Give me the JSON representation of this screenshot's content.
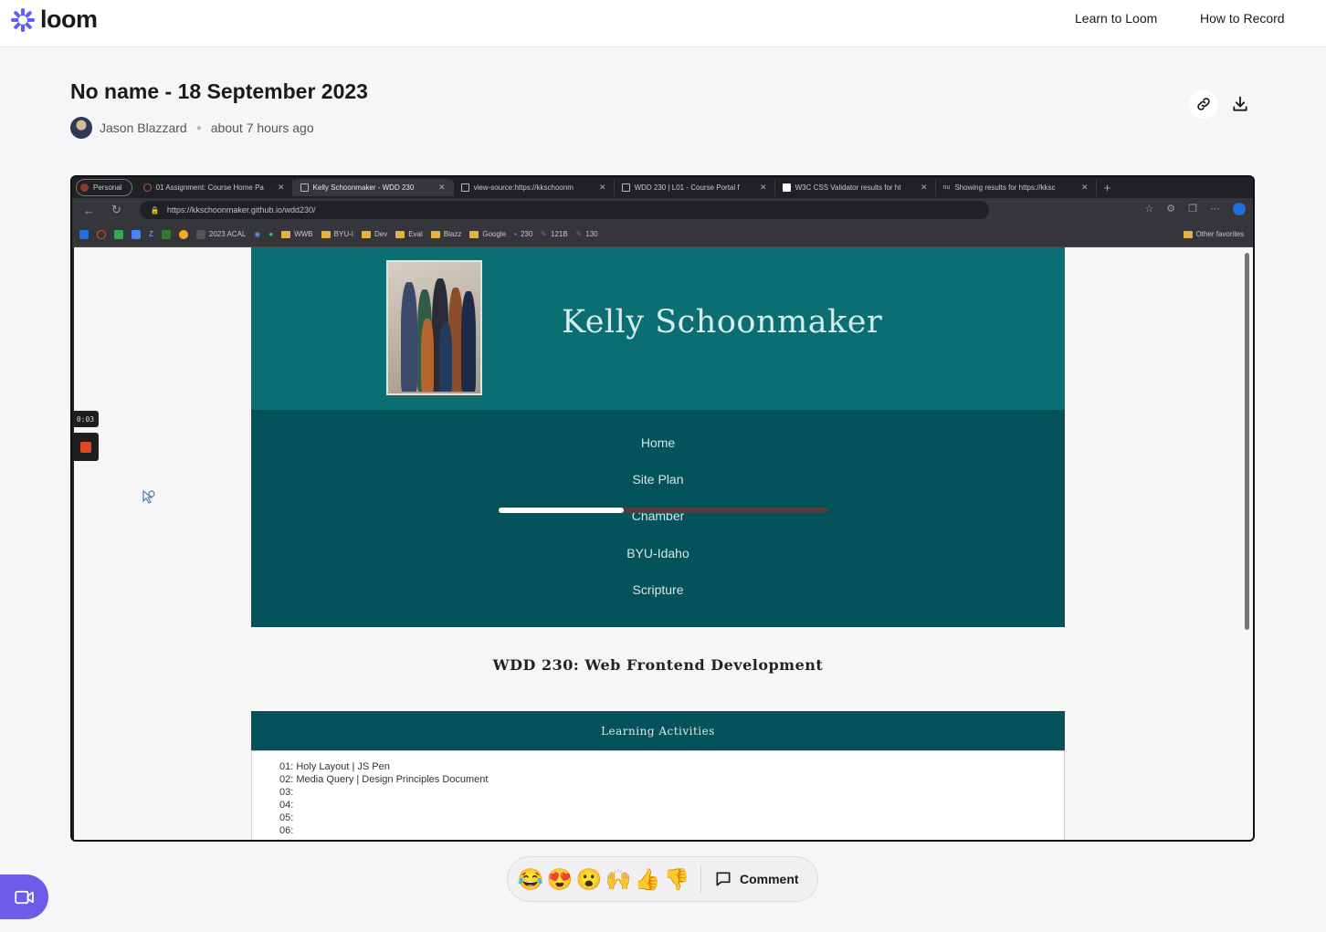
{
  "header": {
    "logo_text": "loom",
    "nav": [
      "Learn to Loom",
      "How to Record"
    ]
  },
  "video": {
    "title": "No name - 18 September 2023",
    "author": "Jason Blazzard",
    "time_ago": "about 7 hours ago",
    "progress_fraction": 0.38
  },
  "browser": {
    "profile": "Personal",
    "tabs": [
      {
        "label": "01 Assignment: Course Home Pa",
        "icon": "byui-icon",
        "color": "#d14f3a"
      },
      {
        "label": "Kelly Schoonmaker - WDD 230",
        "icon": "page-icon",
        "color": "#bbbbbb"
      },
      {
        "label": "view-source:https://kkschoonm",
        "icon": "page-icon",
        "color": "#bbbbbb"
      },
      {
        "label": "WDD 230 | L01 - Course Portal f",
        "icon": "page-icon",
        "color": "#bbbbbb"
      },
      {
        "label": "W3C CSS Validator results for ht",
        "icon": "w3c-icon",
        "color": "#ffffff"
      },
      {
        "label": "Showing results for https://kksc",
        "icon": "nu-icon",
        "color": "#bbbbbb"
      }
    ],
    "url": "https://kkschoonmaker.github.io/wdd230/",
    "bookmarks": [
      "2023 ACAL",
      "WWB",
      "BYU-I",
      "Dev",
      "Eval",
      "Blazz",
      "Google",
      "230",
      "121B",
      "130"
    ],
    "other_favorites": "Other favorites"
  },
  "site": {
    "name": "Kelly Schoonmaker",
    "nav": [
      "Home",
      "Site Plan",
      "Chamber",
      "BYU-Idaho",
      "Scripture"
    ],
    "course_heading": "WDD 230: Web Frontend Development",
    "panel_title": "Learning Activities",
    "activities": [
      "01: Holy Layout | JS Pen",
      "02: Media Query | Design Principles Document",
      "03:",
      "04:",
      "05:",
      "06:"
    ]
  },
  "recording": {
    "elapsed": "0:03"
  },
  "reactions": {
    "emojis": [
      "😂",
      "😍",
      "😮",
      "🙌",
      "👍",
      "👎"
    ],
    "comment_label": "Comment"
  },
  "colors": {
    "accent": "#6c5ce7",
    "site_header": "#0a6e72",
    "site_nav": "#05535a"
  }
}
